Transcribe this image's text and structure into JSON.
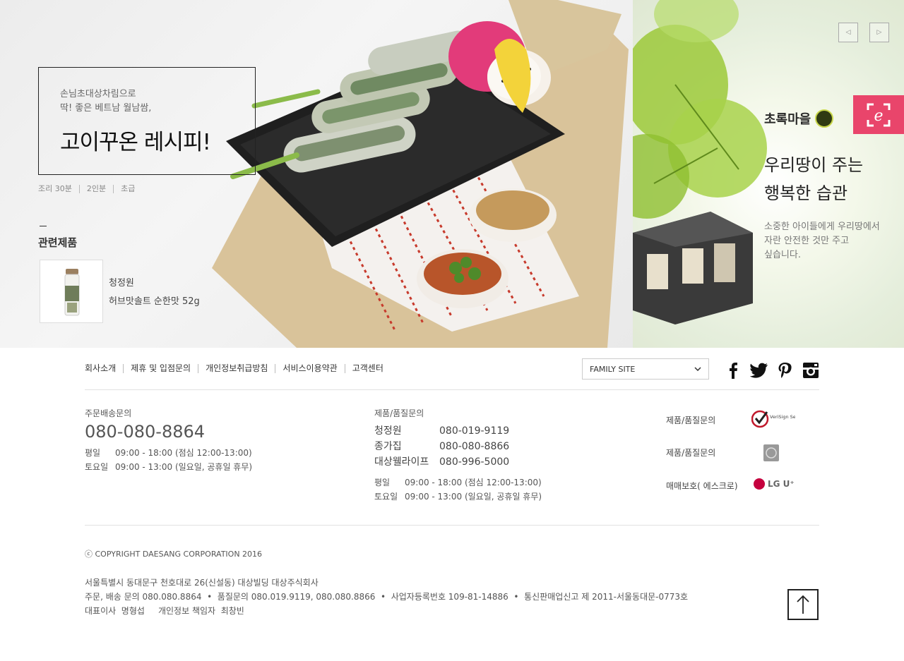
{
  "hero": {
    "subtitle": "손님초대상차림으로\n딱! 좋은 베트남 월남쌈,",
    "title": "고이꾸온 레시피!",
    "meta": [
      "조리 30분",
      "2인분",
      "초급"
    ],
    "related_title": "관련제품",
    "product": {
      "brand": "청정원",
      "name": "허브맛솔트 순한맛 52g"
    }
  },
  "promo": {
    "brand": "초록마을",
    "headline": "우리땅이 주는\n행복한 습관",
    "description": "소중한 아이들에게 우리땅에서\n자란 안전한 것만 주고\n싶습니다.",
    "prev_icon": "◁",
    "next_icon": "▷",
    "badge_icon": "e-logo-icon",
    "badge_color": "#e9456b"
  },
  "footer": {
    "nav": [
      "회사소개",
      "제휴 및 입점문의",
      "개인정보취급방침",
      "서비스이용약관",
      "고객센터"
    ],
    "family_site": "FAMILY SITE",
    "delivery": {
      "label": "주문배송문의",
      "phone": "080-080-8864",
      "hours": [
        {
          "day": "평일",
          "time": "09:00 - 18:00 (점심 12:00-13:00)"
        },
        {
          "day": "토요일",
          "time": "09:00 - 13:00 (일요일, 공휴일 휴무)"
        }
      ]
    },
    "quality": {
      "label": "제품/품질문의",
      "rows": [
        {
          "name": "청정원",
          "phone": "080-019-9119"
        },
        {
          "name": "종가집",
          "phone": "080-080-8866"
        },
        {
          "name": "대상웰라이프",
          "phone": "080-996-5000"
        }
      ],
      "hours": [
        {
          "day": "평일",
          "time": "09:00 - 18:00 (점심 12:00-13:00)"
        },
        {
          "day": "토요일",
          "time": "09:00 - 13:00 (일요일, 공휴일 휴무)"
        }
      ]
    },
    "certs": [
      {
        "label": "제품/품질문의",
        "badge": "VeriSign Secured"
      },
      {
        "label": "제품/품질문의",
        "badge": "seal"
      },
      {
        "label": "매매보호( 에스크로)",
        "badge": "LG U⁺"
      }
    ],
    "copyright": "ⓒ COPYRIGHT DAESANG CORPORATION 2016",
    "address": [
      "서울특별시 동대문구 천호대로 26(신설동) 대상빌딩 대상주식회사",
      "주문, 배송 문의 080.080.8864  •  품질문의 080.019.9119, 080.080.8866  •  사업자등록번호 109-81-14886  •  통신판매업신고 제 2011-서울동대문-0773호",
      "대표이사  명형섭     개인정보 책임자  최창빈"
    ]
  }
}
